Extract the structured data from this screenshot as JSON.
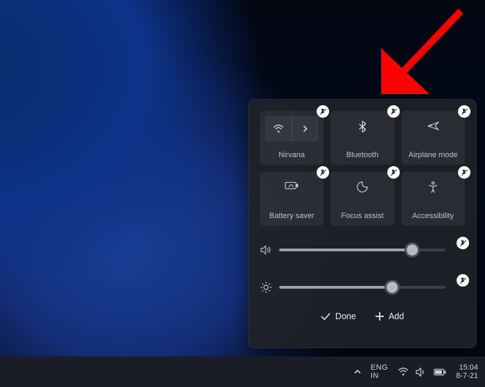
{
  "tiles": [
    {
      "id": "wifi",
      "label": "Nirvana",
      "icon": "wifi-icon"
    },
    {
      "id": "bluetooth",
      "label": "Bluetooth",
      "icon": "bluetooth-icon"
    },
    {
      "id": "airplane",
      "label": "Airplane mode",
      "icon": "airplane-icon"
    },
    {
      "id": "battery-saver",
      "label": "Battery saver",
      "icon": "battery-saver-icon"
    },
    {
      "id": "focus-assist",
      "label": "Focus assist",
      "icon": "focus-assist-icon"
    },
    {
      "id": "accessibility",
      "label": "Accessibility",
      "icon": "accessibility-icon"
    }
  ],
  "sliders": {
    "volume": {
      "percent": 80
    },
    "brightness": {
      "percent": 68
    }
  },
  "actions": {
    "done_label": "Done",
    "add_label": "Add"
  },
  "taskbar": {
    "language_line1": "ENG",
    "language_line2": "IN",
    "time": "15:04",
    "date": "8-7-21"
  },
  "annotation": {
    "arrow_target": "bluetooth-unpin"
  }
}
